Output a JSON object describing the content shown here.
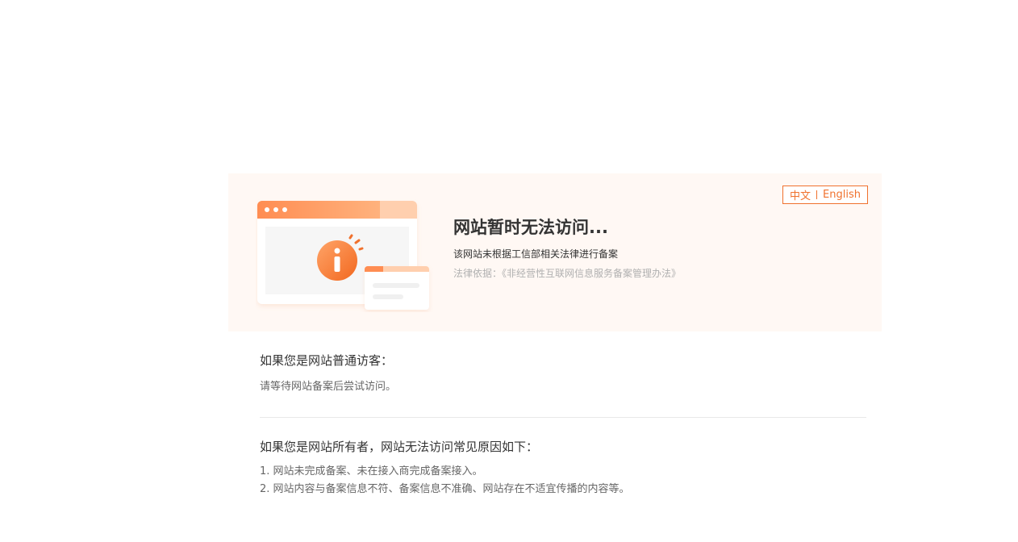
{
  "language_switch": {
    "zh_label": "中文",
    "en_label": "English"
  },
  "banner": {
    "title": "网站暂时无法访问...",
    "subtitle": "该网站未根据工信部相关法律进行备案",
    "law_basis": "法律依据：《非经营性互联网信息服务备案管理办法》"
  },
  "visitor_section": {
    "heading": "如果您是网站普通访客：",
    "text": "请等待网站备案后尝试访问。"
  },
  "owner_section": {
    "heading": "如果您是网站所有者，网站无法访问常见原因如下：",
    "reasons": [
      "1. 网站未完成备案、未在接入商完成备案接入。",
      "2. 网站内容与备案信息不符、备案信息不准确、网站存在不适宜传播的内容等。"
    ]
  },
  "colors": {
    "accent": "#f0712d",
    "banner_bg": "#fff8f4"
  },
  "icons": {
    "illustration": "browser-info-icon"
  }
}
